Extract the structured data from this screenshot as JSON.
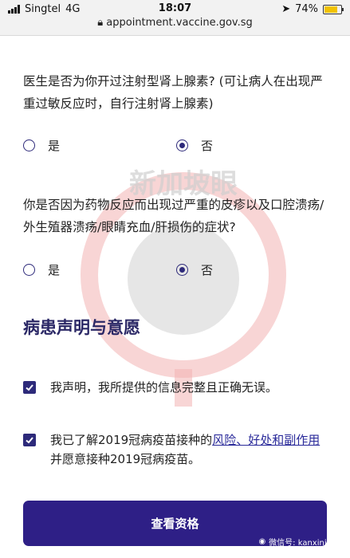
{
  "status_bar": {
    "carrier": "Singtel",
    "network": "4G",
    "time": "18:07",
    "battery": "74%",
    "url": "appointment.vaccine.gov.sg"
  },
  "questions": [
    {
      "text": "医生是否为你开过注射型肾上腺素? (可让病人在出现严重过敏反应时，自行注射肾上腺素)",
      "options": [
        "是",
        "否"
      ],
      "selected": "否"
    },
    {
      "text": "你是否因为药物反应而出现过严重的皮疹以及口腔溃疡/外生殖器溃疡/眼睛充血/肝损伤的症状?",
      "options": [
        "是",
        "否"
      ],
      "selected": "否"
    }
  ],
  "declaration": {
    "title": "病患声明与意愿",
    "item1": "我声明，我所提供的信息完整且正确无误。",
    "item2_before": "我已了解2019冠病疫苗接种的",
    "item2_link": "风险、好处和副作用",
    "item2_after": "并愿意接种2019冠病疫苗。"
  },
  "button": {
    "label": "查看资格"
  },
  "watermark": {
    "text": "新加坡眼"
  },
  "credit": "微信号: kanxinjiapo",
  "colors": {
    "primary": "#2e1f86",
    "text": "#222222",
    "watermark": "#e05a5a"
  }
}
